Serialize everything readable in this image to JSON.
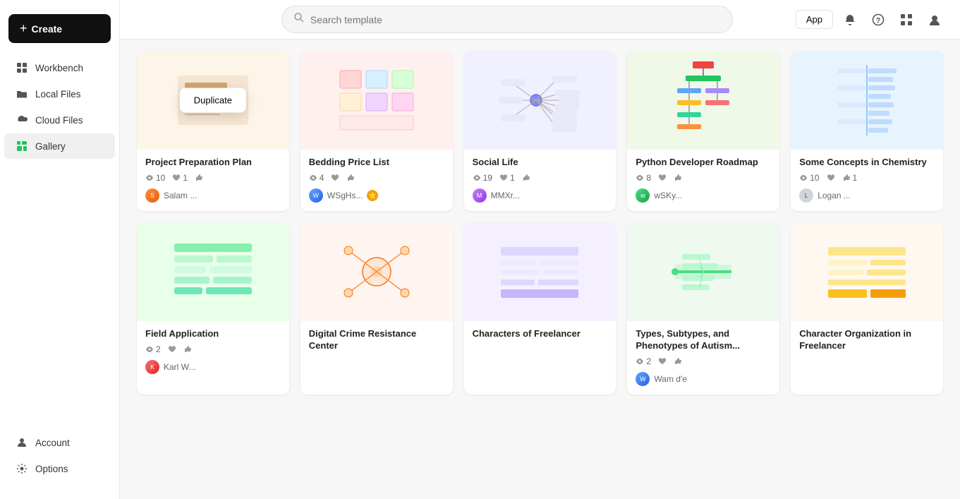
{
  "sidebar": {
    "create_label": "Create",
    "items": [
      {
        "id": "workbench",
        "label": "Workbench",
        "icon": "grid"
      },
      {
        "id": "local-files",
        "label": "Local Files",
        "icon": "folder"
      },
      {
        "id": "cloud-files",
        "label": "Cloud Files",
        "icon": "cloud"
      },
      {
        "id": "gallery",
        "label": "Gallery",
        "icon": "gallery",
        "active": true
      }
    ],
    "bottom_items": [
      {
        "id": "account",
        "label": "Account",
        "icon": "user"
      },
      {
        "id": "options",
        "label": "Options",
        "icon": "settings"
      }
    ]
  },
  "topbar": {
    "app_button": "App",
    "search_placeholder": "Search template"
  },
  "cards": [
    {
      "id": "project-preparation",
      "title": "Project Preparation Plan",
      "views": 10,
      "likes": 1,
      "thumbups": 0,
      "author": "Salam ...",
      "avatar_color": "orange",
      "has_duplicate": true,
      "thumb_style": "thumb-project"
    },
    {
      "id": "bedding-price",
      "title": "Bedding Price List",
      "views": 4,
      "likes": 0,
      "thumbups": 0,
      "author": "WSgHs...",
      "avatar_color": "blue",
      "has_badge": true,
      "thumb_style": "thumb-bedding"
    },
    {
      "id": "social-life",
      "title": "Social Life",
      "views": 19,
      "likes": 1,
      "thumbups": 0,
      "author": "MMXr...",
      "avatar_color": "purple",
      "thumb_style": "thumb-social"
    },
    {
      "id": "python-roadmap",
      "title": "Python Developer Roadmap",
      "views": 8,
      "likes": 0,
      "thumbups": 0,
      "author": "wSKy...",
      "avatar_color": "green",
      "thumb_style": "thumb-python"
    },
    {
      "id": "some-concepts-chemistry",
      "title": "Some Concepts in Chemistry",
      "views": 10,
      "likes": 0,
      "thumbups": 1,
      "author": "Logan ...",
      "avatar_color": "photo",
      "thumb_style": "thumb-chemistry"
    },
    {
      "id": "field-application",
      "title": "Field Application",
      "views": 2,
      "likes": 0,
      "thumbups": 0,
      "author": "Karl W...",
      "avatar_color": "red",
      "thumb_style": "thumb-field"
    },
    {
      "id": "digital-crime",
      "title": "Digital Crime Resistance Center",
      "views": 0,
      "likes": 0,
      "thumbups": 0,
      "author": "",
      "avatar_color": "gray",
      "thumb_style": "thumb-digital",
      "partial": true
    },
    {
      "id": "characters-freelancer",
      "title": "Characters of Freelancer",
      "views": 0,
      "likes": 0,
      "thumbups": 0,
      "author": "",
      "avatar_color": "purple",
      "thumb_style": "thumb-freelancer",
      "partial": true
    },
    {
      "id": "types-autism",
      "title": "Types, Subtypes, and Phenotypes of Autism...",
      "views": 2,
      "likes": 0,
      "thumbups": 0,
      "author": "Wam d'e",
      "avatar_color": "blue",
      "thumb_style": "thumb-autism"
    },
    {
      "id": "char-org-freelancer",
      "title": "Character Organization in Freelancer",
      "views": 0,
      "likes": 0,
      "thumbups": 0,
      "author": "",
      "avatar_color": "gray",
      "thumb_style": "thumb-charorg",
      "partial": true
    }
  ],
  "duplicate_label": "Duplicate"
}
